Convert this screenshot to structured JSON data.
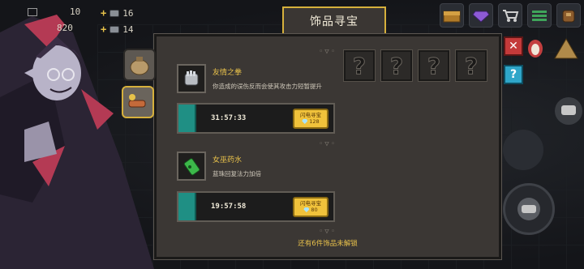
{
  "hud": {
    "hp_value": "10",
    "gold_value": "820",
    "res1_value": "16",
    "res2_value": "14"
  },
  "dialog": {
    "title": "饰品寻宝",
    "deco_top": "◦▽◦",
    "deco_mid": "◦▽◦",
    "items": [
      {
        "name": "友情之拳",
        "description": "你造成的误伤反而会使其攻击力短暂提升",
        "timer": "31:57:33",
        "flash_label": "闪电寻宝",
        "flash_cost": "128",
        "icon": "fist-icon"
      },
      {
        "name": "女巫药水",
        "description": "蓝珠回复法力加倍",
        "timer": "19:57:58",
        "flash_label": "闪电寻宝",
        "flash_cost": "80",
        "icon": "potion-icon"
      }
    ],
    "locked_slot_symbol": "?",
    "footer_text": "还有6件饰品未解锁",
    "close_symbol": "✕",
    "help_symbol": "?"
  },
  "colors": {
    "accent_gold": "#e9c24b",
    "teal": "#1f8f84",
    "panel": "#3b3734"
  }
}
